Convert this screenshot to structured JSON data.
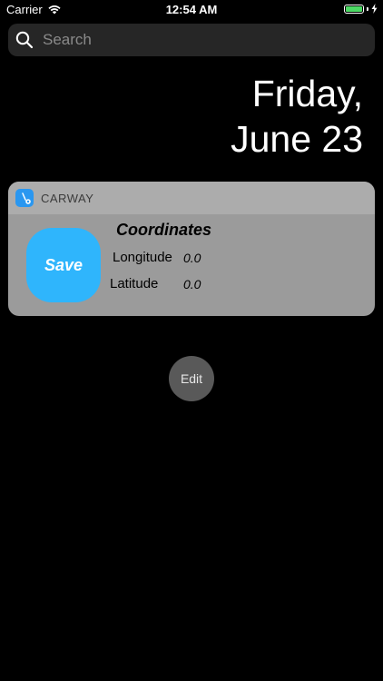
{
  "status_bar": {
    "carrier": "Carrier",
    "time": "12:54 AM",
    "battery_level": 1.0,
    "battery_color": "#4cd964",
    "wifi_icon": "wifi-icon",
    "charging_icon": "charging-bolt-icon"
  },
  "search": {
    "placeholder": "Search",
    "value": "",
    "icon": "search-icon"
  },
  "date": {
    "line1": "Friday,",
    "line2": "June 23"
  },
  "widget": {
    "app_name": "CARWAY",
    "app_icon": "carway-app-icon",
    "accent_color": "#2fb5fc",
    "save_label": "Save",
    "coordinates_title": "Coordinates",
    "longitude_label": "Longitude",
    "longitude_value": "0.0",
    "latitude_label": "Latitude",
    "latitude_value": "0.0"
  },
  "edit_label": "Edit"
}
